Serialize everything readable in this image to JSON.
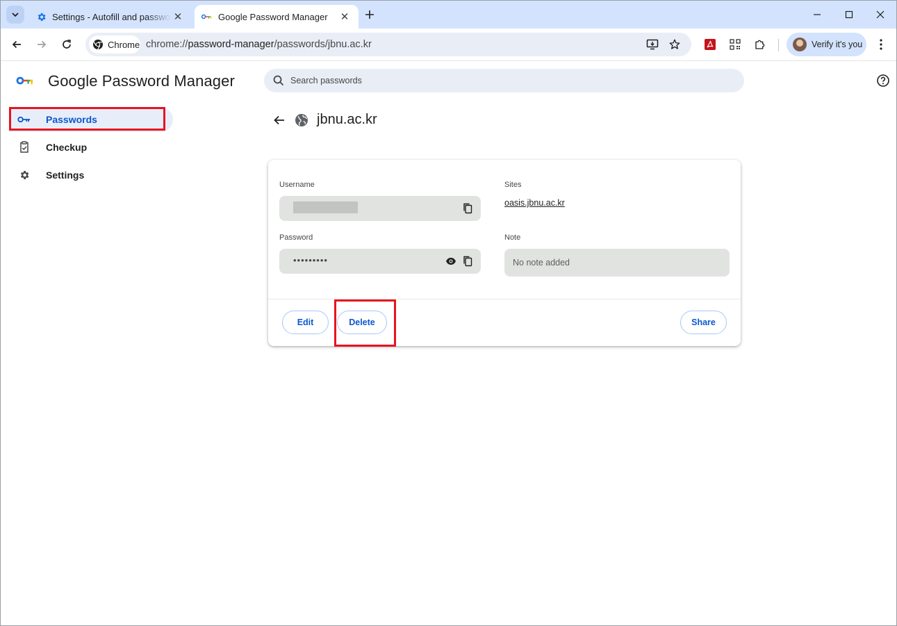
{
  "browser": {
    "tabs": [
      {
        "title": "Settings - Autofill and passwords",
        "favicon": "gear-icon",
        "active": false
      },
      {
        "title": "Google Password Manager",
        "favicon": "key-icon",
        "active": true
      }
    ],
    "address_chip": "Chrome",
    "url_scheme": "chrome://",
    "url_host": "password-manager",
    "url_path": "/passwords/jbnu.ac.kr",
    "profile_label": "Verify it's you"
  },
  "app": {
    "title": "Google Password Manager",
    "search_placeholder": "Search passwords"
  },
  "sidebar": {
    "items": [
      {
        "label": "Passwords",
        "icon": "key-icon",
        "selected": true
      },
      {
        "label": "Checkup",
        "icon": "clipboard-check-icon",
        "selected": false
      },
      {
        "label": "Settings",
        "icon": "gear-icon",
        "selected": false
      }
    ]
  },
  "detail": {
    "title": "jbnu.ac.kr",
    "username_label": "Username",
    "password_label": "Password",
    "password_masked": "•••••••••",
    "sites_label": "Sites",
    "site": "oasis.jbnu.ac.kr",
    "note_label": "Note",
    "note_value": "No note added",
    "buttons": {
      "edit": "Edit",
      "delete": "Delete",
      "share": "Share"
    }
  },
  "colors": {
    "accent": "#0b57d0",
    "tabstrip": "#d3e3fd",
    "highlight": "#e8141f"
  }
}
